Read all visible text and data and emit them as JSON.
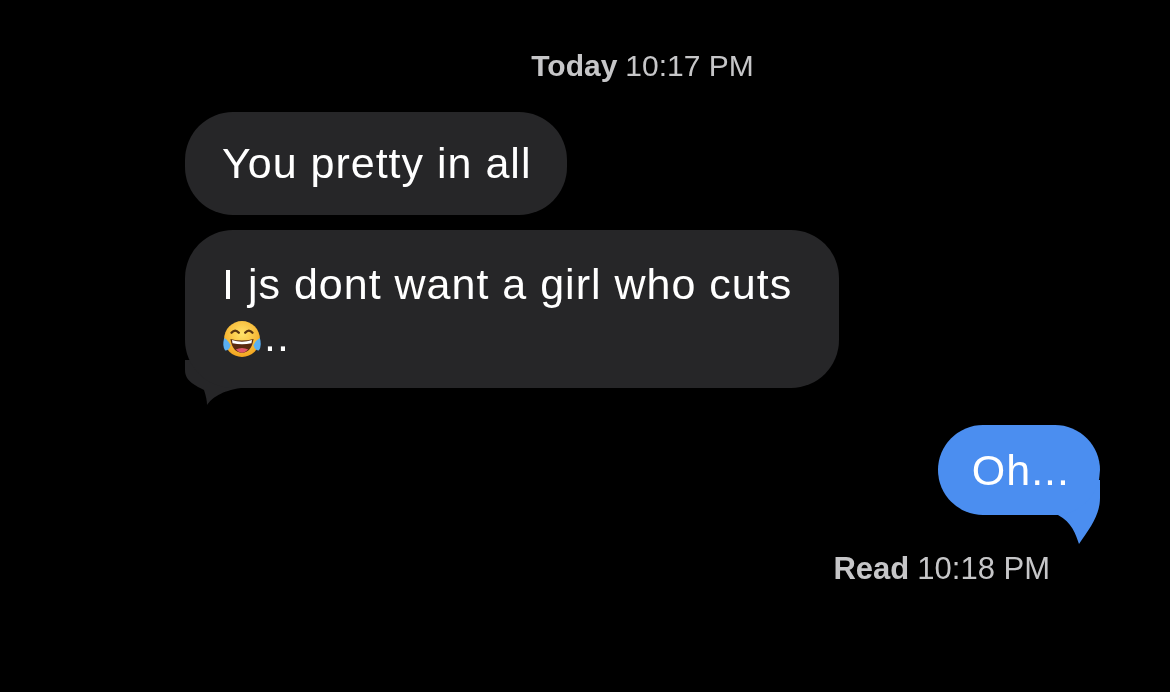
{
  "timestamp": {
    "day": "Today",
    "time": "10:17 PM"
  },
  "messages": [
    {
      "kind": "incoming",
      "tail": false,
      "segments": [
        {
          "kind": "text",
          "text": "You pretty in all"
        }
      ]
    },
    {
      "kind": "incoming",
      "tail": true,
      "segments": [
        {
          "kind": "text",
          "text": "I js dont want a girl who cuts"
        },
        {
          "kind": "emoji"
        },
        {
          "kind": "text",
          "text": ".."
        }
      ]
    },
    {
      "kind": "outgoing",
      "tail": true,
      "segments": [
        {
          "kind": "text",
          "text": "Oh..."
        }
      ]
    }
  ],
  "read_receipt": {
    "status": "Read",
    "time": "10:18 PM"
  }
}
